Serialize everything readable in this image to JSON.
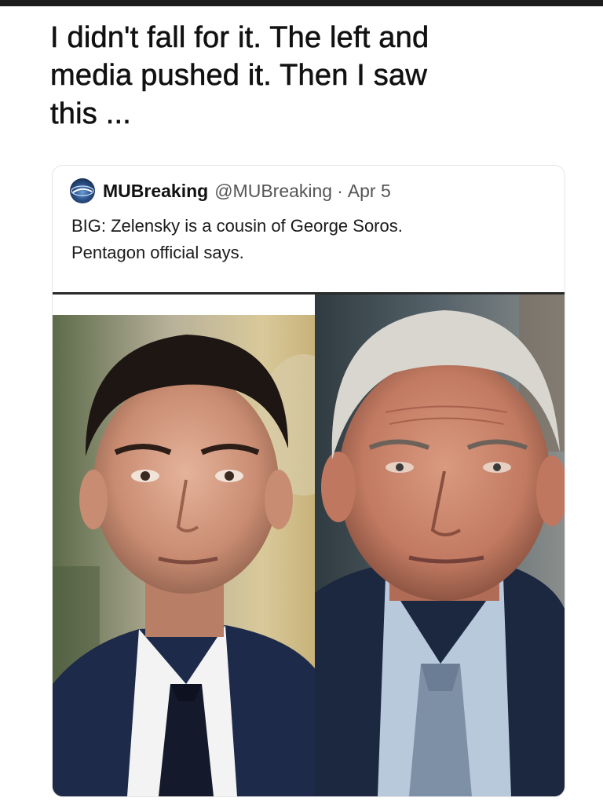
{
  "headline": {
    "lines": [
      "I didn't fall for it.  The left and",
      "media pushed it. Then I saw",
      "this ..."
    ]
  },
  "tweet": {
    "display_name": "MUBreaking",
    "handle": "@MUBreaking",
    "separator": "·",
    "date": "Apr 5",
    "text_lines": [
      "BIG: Zelensky is a cousin of George Soros.",
      "Pentagon official says."
    ],
    "avatar_icon": "globe-logo-icon"
  },
  "images": [
    {
      "name": "left-portrait-photo"
    },
    {
      "name": "right-portrait-photo"
    }
  ],
  "colors": {
    "background": "#ffffff",
    "text": "#111111",
    "handle_gray": "#555555",
    "suit_navy": "#1d2a4a"
  }
}
